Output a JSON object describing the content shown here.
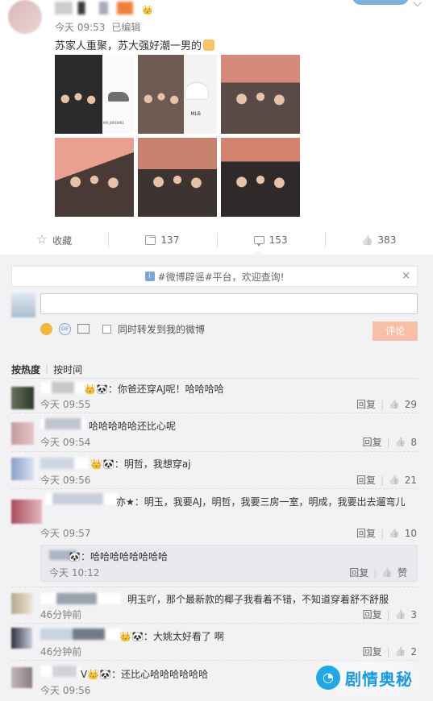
{
  "post": {
    "time": "今天 09:53",
    "edited": "已编辑",
    "text": "苏家人重聚，苏大强好潮一男的",
    "vip_badge": "👑"
  },
  "photos": [
    {
      "caption_1": "AIR JORDAN1"
    },
    {
      "caption_1": "MLB"
    },
    {},
    {},
    {},
    {}
  ],
  "actions": {
    "favorite": "收藏",
    "repost_count": "137",
    "comment_count": "153",
    "like_count": "383"
  },
  "notice": {
    "text": "#微博辟谣#平台，欢迎查询!",
    "close": "×"
  },
  "composer": {
    "repost_label": "同时转发到我的微博",
    "submit": "评论",
    "gif": "GIF"
  },
  "sort": {
    "by_hot": "按热度",
    "separator": "|",
    "by_time": "按时间"
  },
  "comments": [
    {
      "text": "👑🐼：你爸还穿AJ呢！哈哈哈哈",
      "time": "今天 09:55",
      "reply": "回复",
      "likes": "29"
    },
    {
      "text": "哈哈哈哈哈还比心呢",
      "time": "今天 09:54",
      "reply": "回复",
      "likes": "8"
    },
    {
      "text": "👑🐼：明哲，我想穿aj",
      "time": "今天 09:56",
      "reply": "回复",
      "likes": "21"
    },
    {
      "text": "亦★：明玉，我要AJ，明哲，我要三房一室，明成，我要出去遛弯儿",
      "time": "今天 09:57",
      "reply": "回复",
      "likes": "10"
    },
    {
      "text": "明玉吖，那个最新款的椰子我看着不错，不知道穿着舒不舒服",
      "time": "46分钟前",
      "reply": "回复",
      "likes": "3"
    },
    {
      "text": "👑🐼：大姚太好看了 啊",
      "time": "46分钟前",
      "reply": "回复",
      "likes": "2"
    },
    {
      "text": "V👑🐼：还比心哈哈哈哈哈哈",
      "time": "今天 09:56",
      "reply": "回复",
      "likes": ""
    }
  ],
  "nested_reply": {
    "text": "🐼：哈哈哈哈哈哈哈哈",
    "time": "今天 10:12",
    "reply": "回复",
    "like": "赞"
  },
  "watermark": {
    "text": "剧情奥秘"
  },
  "colors": {
    "panel_bg": "#f2f2f5",
    "submit_bg": "#f7bfa5",
    "watermark": "#1b9ae0"
  }
}
